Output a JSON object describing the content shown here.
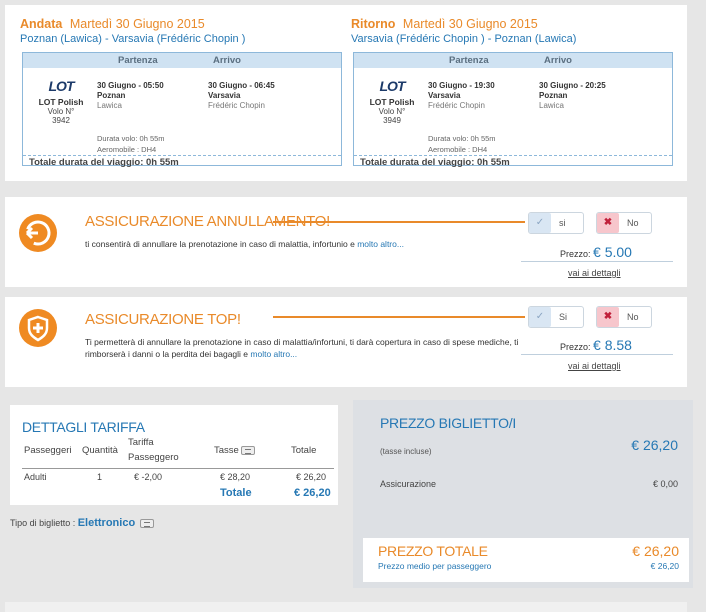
{
  "outbound": {
    "label": "Andata",
    "date": "Martedì 30 Giugno 2015",
    "route": "Poznan (Lawica) - Varsavia (Frédéric Chopin )",
    "header_departure": "Partenza",
    "header_arrival": "Arrivo",
    "airline": "LOT Polish",
    "logo_text": "LOT",
    "flight_label": "Volo N°",
    "flight_number": "3942",
    "dep_time": "30 Giugno - 05:50",
    "dep_city": "Poznan",
    "dep_airport": "Lawica",
    "arr_time": "30 Giugno - 06:45",
    "arr_city": "Varsavia",
    "arr_airport": "Frédéric Chopin",
    "duration": "Durata volo: 0h 55m",
    "aircraft": "Aeromobile : DH4",
    "total": "Totale durata del viaggio: 0h 55m"
  },
  "return": {
    "label": "Ritorno",
    "date": "Martedì 30 Giugno 2015",
    "route": "Varsavia (Frédéric Chopin ) - Poznan (Lawica)",
    "header_departure": "Partenza",
    "header_arrival": "Arrivo",
    "airline": "LOT Polish",
    "logo_text": "LOT",
    "flight_label": "Volo N°",
    "flight_number": "3949",
    "dep_time": "30 Giugno - 19:30",
    "dep_city": "Varsavia",
    "dep_airport": "Frédéric Chopin",
    "arr_time": "30 Giugno - 20:25",
    "arr_city": "Poznan",
    "arr_airport": "Lawica",
    "duration": "Durata volo: 0h 55m",
    "aircraft": "Aeromobile : DH4",
    "total": "Totale durata del viaggio: 0h 55m"
  },
  "insurance_cancel": {
    "title": "ASSICURAZIONE ANNULLAMENTO!",
    "text": "ti consentirà di annullare la prenotazione in caso di malattia, infortunio e",
    "more": "molto altro...",
    "yes_label": "si",
    "no_label": "No",
    "price_label": "Prezzo:",
    "price": "€ 5.00",
    "details": "vai ai dettagli",
    "icon": "undo-arrow-icon"
  },
  "insurance_top": {
    "title": "ASSICURAZIONE TOP!",
    "text": "Ti permetterà di annullare la prenotazione in caso di malattia/infortuni, ti darà copertura in caso di spese mediche, ti rimborserà i danni o la perdita dei bagagli e",
    "more": "molto altro...",
    "yes_label": "Si",
    "no_label": "No",
    "price_label": "Prezzo:",
    "price": "€ 8.58",
    "details": "vai ai dettagli",
    "icon": "shield-plus-icon"
  },
  "fare": {
    "title": "DETTAGLI TARIFFA",
    "columns": [
      "Passeggeri",
      "Quantità",
      "Tariffa Passeggero",
      "Tasse",
      "Totale"
    ],
    "rows": [
      {
        "passenger": "Adulti",
        "qty": "1",
        "fare": "€ -2,00",
        "tax": "€ 28,20",
        "total": "€ 26,20"
      }
    ],
    "total_label": "Totale",
    "total_value": "€ 26,20",
    "ticket_type_label": "Tipo di biglietto :",
    "ticket_type": "Elettronico"
  },
  "summary": {
    "title": "PREZZO BIGLIETTO/I",
    "taxes_note": "(tasse incluse)",
    "ticket_price": "€ 26,20",
    "insurance_label": "Assicurazione",
    "insurance_value": "€ 0,00",
    "total_title": "PREZZO TOTALE",
    "total_value": "€ 26,20",
    "avg_label": "Prezzo medio per passeggero",
    "avg_value": "€ 26,20"
  },
  "colors": {
    "accent": "#e98a2a",
    "link": "#2678b4"
  }
}
